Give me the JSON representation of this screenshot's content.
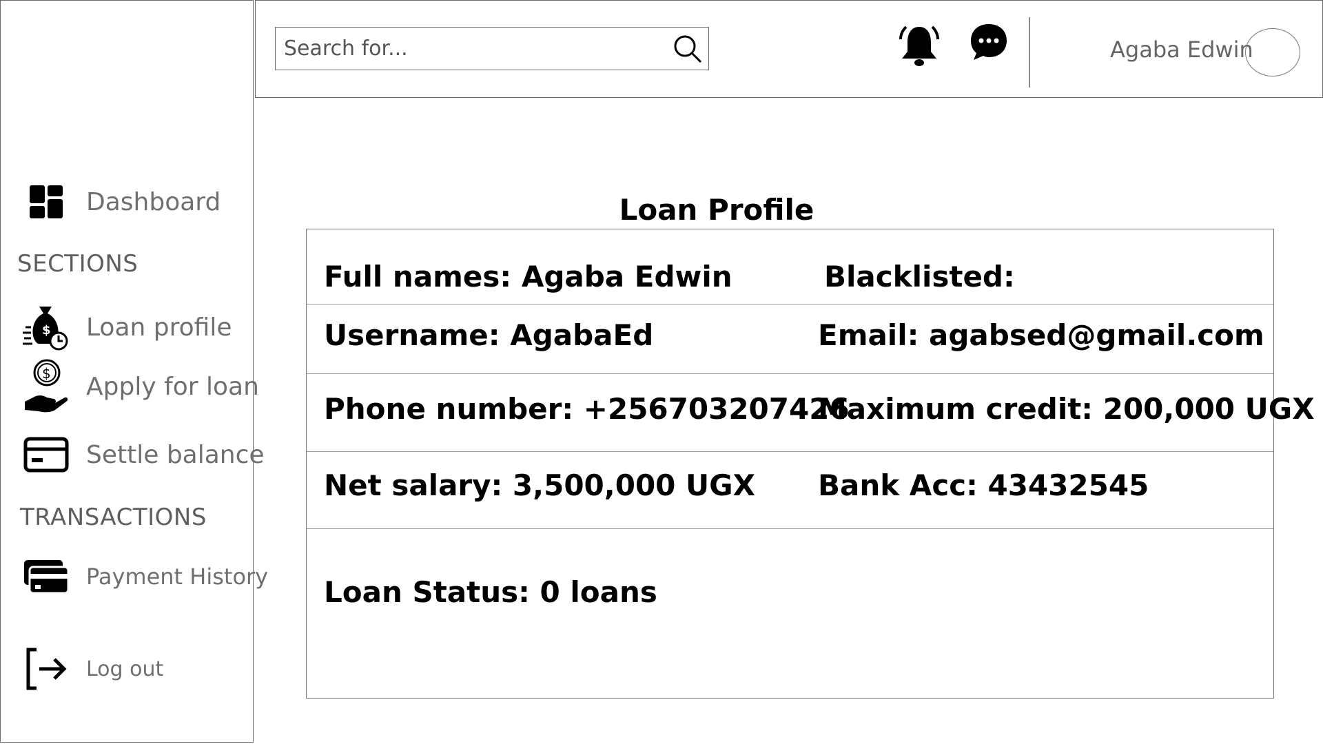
{
  "sidebar": {
    "dashboard_label": "Dashboard",
    "sections_heading": "SECTIONS",
    "loan_profile_label": "Loan profile",
    "apply_loan_label": "Apply for loan",
    "settle_balance_label": "Settle balance",
    "transactions_heading": "TRANSACTIONS",
    "payment_history_label": "Payment History",
    "logout_label": "Log out",
    "icons": [
      "dashboard-icon",
      "money-bag-icon",
      "hand-dollar-icon",
      "credit-card-icon",
      "cards-stack-icon",
      "logout-icon"
    ]
  },
  "header": {
    "search_placeholder": "Search for...",
    "user_name": "Agaba Edwin",
    "icons": [
      "search-icon",
      "bell-icon",
      "chat-icon"
    ]
  },
  "profile": {
    "title": "Loan Profile",
    "full_names": "Full names: Agaba Edwin",
    "blacklisted": "Blacklisted:",
    "username": "Username: AgabaEd",
    "email": "Email: agabsed@gmail.com",
    "phone": "Phone number: +256703207426",
    "max_credit": "Maximum credit: 200,000 UGX",
    "net_salary": "Net salary: 3,500,000 UGX",
    "bank_acc": "Bank Acc: 43432545",
    "loan_status": "Loan Status: 0 loans"
  }
}
